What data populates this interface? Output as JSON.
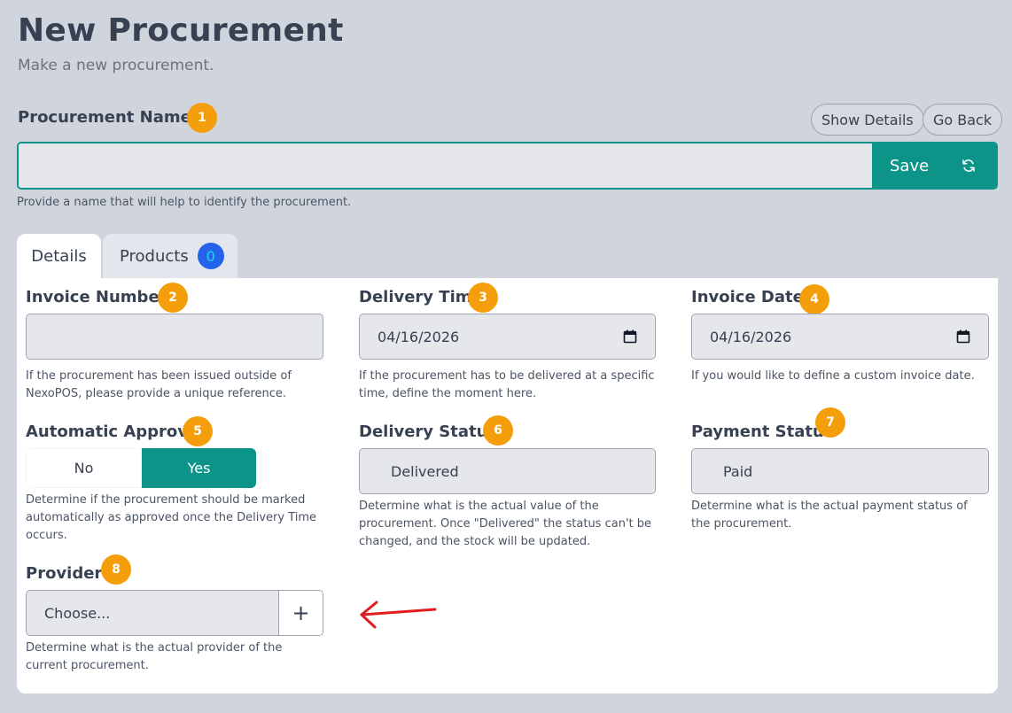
{
  "header": {
    "title": "New Procurement",
    "subtitle": "Make a new procurement."
  },
  "annotations": {
    "badge_1": "1",
    "badge_2": "2",
    "badge_3": "3",
    "badge_4": "4",
    "badge_5": "5",
    "badge_6": "6",
    "badge_7": "7",
    "badge_8": "8",
    "badge_color": "#f59e0b",
    "arrow_color": "#e11d1d"
  },
  "procurement_name": {
    "label": "Procurement Name",
    "value": "",
    "help": "Provide a name that will help to identify the procurement.",
    "save_label": "Save"
  },
  "actions": {
    "show_details": "Show Details",
    "go_back": "Go Back"
  },
  "tabs": [
    {
      "label": "Details",
      "active": true
    },
    {
      "label": "Products",
      "count": "0"
    }
  ],
  "fields": {
    "invoice_number": {
      "label": "Invoice Number",
      "value": "",
      "help": "If the procurement has been issued outside of NexoPOS, please provide a unique reference."
    },
    "delivery_time": {
      "label": "Delivery Time",
      "value": "04/16/2026",
      "help": "If the procurement has to be delivered at a specific time, define the moment here."
    },
    "invoice_date": {
      "label": "Invoice Date",
      "value": "04/16/2026",
      "help": "If you would like to define a custom invoice date."
    },
    "automatic_approval": {
      "label": "Automatic Approval",
      "options": [
        "No",
        "Yes"
      ],
      "selected": "Yes",
      "help": "Determine if the procurement should be marked automatically as approved once the Delivery Time occurs."
    },
    "delivery_status": {
      "label": "Delivery Status",
      "value": "Delivered",
      "help": "Determine what is the actual value of the procurement. Once \"Delivered\" the status can't be changed, and the stock will be updated."
    },
    "payment_status": {
      "label": "Payment Status",
      "value": "Paid",
      "help": "Determine what is the actual payment status of the procurement."
    },
    "provider": {
      "label": "Provider",
      "value": "Choose...",
      "add_symbol": "+",
      "help": "Determine what is the actual provider of the current procurement."
    }
  },
  "colors": {
    "accent": "#0d9488",
    "background": "#d0d4dc",
    "panel": "#ffffff",
    "count_badge": "#2563eb"
  }
}
